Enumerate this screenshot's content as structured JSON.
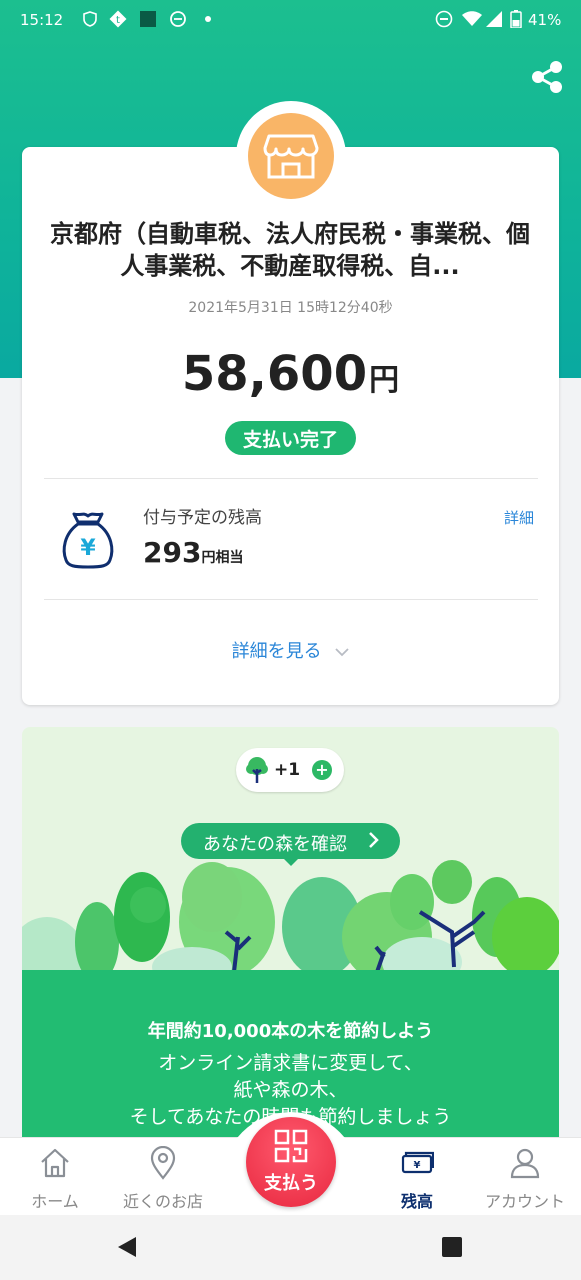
{
  "status_bar": {
    "time": "15:12",
    "battery": "41%"
  },
  "receipt": {
    "title": "京都府（自動車税、法人府民税・事業税、個人事業税、不動産取得税、自...",
    "datetime": "2021年5月31日 15時12分40秒",
    "amount": "58,600",
    "currency": "円",
    "status": "支払い完了",
    "points_label": "付与予定の残高",
    "points_value": "293",
    "points_unit": "円相当",
    "detail_link": "詳細",
    "see_more": "詳細を見る"
  },
  "forest": {
    "tree_count": "+1",
    "button_label": "あなたの森を確認",
    "headline": "年間約10,000本の木を節約しよう",
    "body": "オンライン請求書に変更して、\n紙や森の木、\nそしてあなたの時間も節約しましょう"
  },
  "bottom_nav": {
    "home": "ホーム",
    "nearby": "近くのお店",
    "pay": "支払う",
    "balance": "残高",
    "account": "アカウント"
  },
  "colors": {
    "brand_green": "#1fb771",
    "link_blue": "#2a86d8",
    "pay_red": "#e8283f",
    "active_navy": "#0d2f6e"
  }
}
